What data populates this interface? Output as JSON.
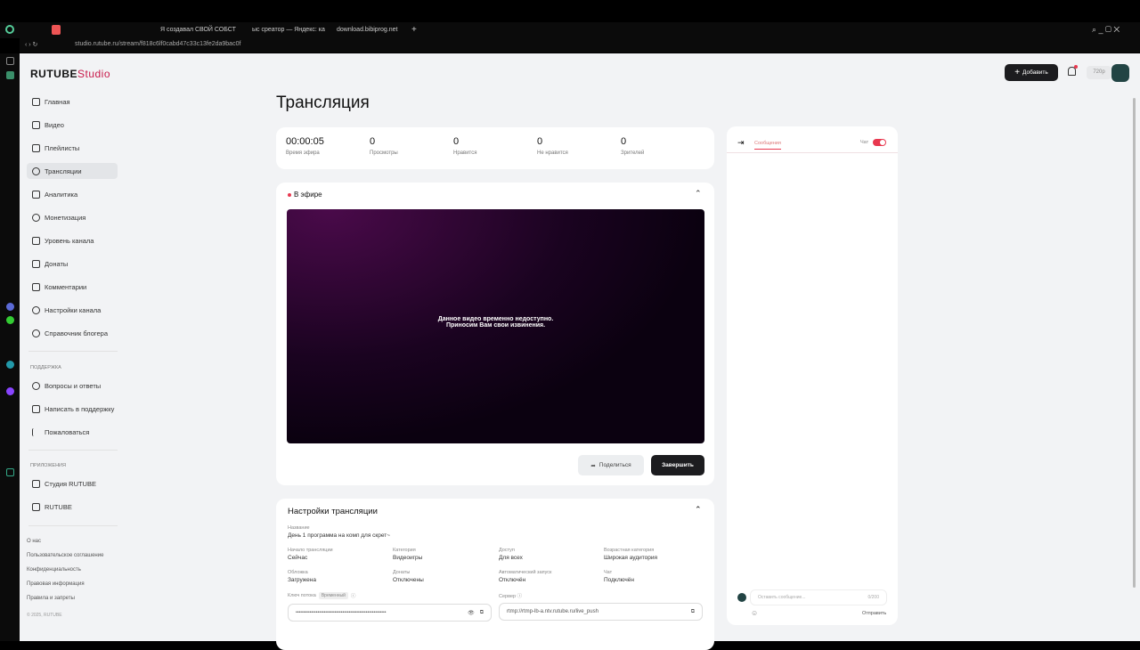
{
  "browser": {
    "tabs": [
      "Я создавал СВОЙ СОБСТ",
      "ыс среатор — Яндекс: ка",
      "download.bibiprog.net"
    ],
    "url": "studio.rutube.ru/stream/f818c6lf0cabd47c33c13fe2da9bac0f"
  },
  "logo": {
    "brand": "RUTUBE",
    "product": "Studio"
  },
  "sidebar": {
    "items": [
      {
        "label": "Главная",
        "icon": "home-icon"
      },
      {
        "label": "Видео",
        "icon": "video-icon"
      },
      {
        "label": "Плейлисты",
        "icon": "playlist-icon"
      },
      {
        "label": "Трансляции",
        "icon": "broadcast-icon"
      },
      {
        "label": "Аналитика",
        "icon": "analytics-icon"
      },
      {
        "label": "Монетизация",
        "icon": "ruble-icon"
      },
      {
        "label": "Уровень канала",
        "icon": "star-icon"
      },
      {
        "label": "Донаты",
        "icon": "wallet-icon"
      },
      {
        "label": "Комментарии",
        "icon": "comment-icon"
      },
      {
        "label": "Настройки канала",
        "icon": "gear-icon"
      },
      {
        "label": "Справочник блогера",
        "icon": "info-icon"
      }
    ],
    "support_title": "ПОДДЕРЖКА",
    "support": [
      {
        "label": "Вопросы и ответы"
      },
      {
        "label": "Написать в поддержку"
      },
      {
        "label": "Пожаловаться"
      }
    ],
    "apps_title": "ПРИЛОЖЕНИЯ",
    "apps": [
      {
        "label": "Студия RUTUBE"
      },
      {
        "label": "RUTUBE"
      }
    ],
    "footer": [
      "О нас",
      "Пользовательское соглашение",
      "Конфиденциальность",
      "Правовая информация",
      "Правила и запреты"
    ],
    "copyright": "© 2025, RUTUBE"
  },
  "header": {
    "add_label": "Добавить",
    "quality": "720p"
  },
  "main": {
    "title": "Трансляция",
    "stats": [
      {
        "value": "00:00:05",
        "label": "Время эфира"
      },
      {
        "value": "0",
        "label": "Просмотры"
      },
      {
        "value": "0",
        "label": "Нравится"
      },
      {
        "value": "0",
        "label": "Не нравится"
      },
      {
        "value": "0",
        "label": "Зрителей"
      }
    ],
    "live": {
      "status": "В эфире",
      "message1": "Данное видео временно недоступно.",
      "message2": "Приносим Вам свои извинения.",
      "share": "Поделиться",
      "finish": "Завершить"
    },
    "settings": {
      "title": "Настройки трансляции",
      "name_label": "Название",
      "name": "День 1 программа на комп для скрет~",
      "fields": [
        {
          "label": "Начало трансляции",
          "value": "Сейчас"
        },
        {
          "label": "Категория",
          "value": "Видеоигры"
        },
        {
          "label": "Доступ",
          "value": "Для всех"
        },
        {
          "label": "Возрастная категория",
          "value": "Широкая аудитория"
        },
        {
          "label": "Обложка",
          "value": "Загружена"
        },
        {
          "label": "Донаты",
          "value": "Отключены"
        },
        {
          "label": "Автоматический запуск",
          "value": "Отключён"
        },
        {
          "label": "Чат",
          "value": "Подключён"
        }
      ],
      "key_label": "Ключ потока",
      "key_badge": "Временный",
      "key_value": "••••••••••••••••••••••••••••••••••••••••••••••••••••••••••",
      "server_label": "Сервер",
      "server_value": "rtmp://rtmp-lb-a.ntv.rutube.ru/live_push"
    }
  },
  "chat": {
    "tab": "Сообщения",
    "toggle_label": "Чат",
    "toggle_on": true,
    "placeholder": "Оставить сообщение...",
    "counter": "0/200",
    "send": "Отправить"
  },
  "colors": {
    "accent": "#e8384f",
    "dark": "#1c1c1f"
  }
}
